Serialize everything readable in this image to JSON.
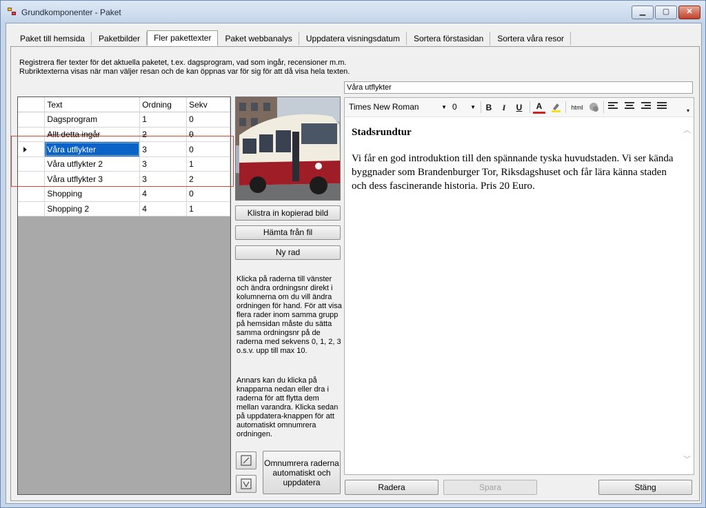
{
  "window": {
    "title": "Grundkomponenter - Paket"
  },
  "tabs": [
    "Paket till hemsida",
    "Paketbilder",
    "Fler pakettexter",
    "Paket webbanalys",
    "Uppdatera visningsdatum",
    "Sortera förstasidan",
    "Sortera våra resor"
  ],
  "info": {
    "line1": "Registrera fler texter för det aktuella paketet, t.ex. dagsprogram, vad som ingår, recensioner m.m.",
    "line2": "Rubriktexterna visas när man väljer resan och de kan öppnas var för sig för att då visa hela texten."
  },
  "grid": {
    "headers": {
      "text": "Text",
      "ordning": "Ordning",
      "sekv": "Sekv"
    },
    "rows": [
      {
        "text": "Dagsprogram",
        "ordning": "1",
        "sekv": "0"
      },
      {
        "text": "Allt detta ingår",
        "ordning": "2",
        "sekv": "0"
      },
      {
        "text": "Våra utflykter",
        "ordning": "3",
        "sekv": "0"
      },
      {
        "text": "Våra utflykter 2",
        "ordning": "3",
        "sekv": "1"
      },
      {
        "text": "Våra utflykter 3",
        "ordning": "3",
        "sekv": "2"
      },
      {
        "text": "Shopping",
        "ordning": "4",
        "sekv": "0"
      },
      {
        "text": "Shopping 2",
        "ordning": "4",
        "sekv": "1"
      }
    ]
  },
  "buttons": {
    "paste": "Klistra in kopierad bild",
    "file": "Hämta från fil",
    "newrow": "Ny rad",
    "renumber": "Omnumrera raderna automatiskt och uppdatera",
    "delete": "Radera",
    "save": "Spara",
    "close": "Stäng"
  },
  "help": {
    "p1": "Klicka på raderna till vänster och ändra ordningsnr direkt i kolumnerna om du vill ändra ordningen för hand. För att visa flera rader inom samma grupp på hemsidan måste du sätta samma ordningsnr på de raderna med sekvens 0, 1, 2, 3 o.s.v. upp till max 10.",
    "p2": "Annars kan du klicka på knapparna nedan eller dra i raderna för att flytta dem mellan varandra. Klicka sedan på uppdatera-knappen för att automatiskt omnumrera ordningen."
  },
  "editor": {
    "title_value": "Våra utflykter",
    "font": "Times New Roman",
    "size": "0",
    "heading": "Stadsrundtur",
    "body": "Vi får en god introduktion till den spännande tyska huvudstaden. Vi ser kända byggnader som Brandenburger Tor, Riksdagshuset och får lära känna staden och dess fascinerande historia. Pris 20 Euro.",
    "html_label": "html"
  }
}
